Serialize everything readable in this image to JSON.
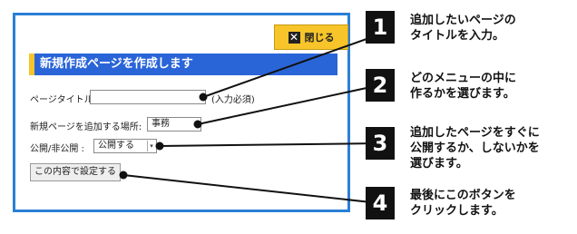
{
  "close_button": {
    "label": "閉じる",
    "icon": "close-icon"
  },
  "panel_title": "新規作成ページを作成します",
  "form": {
    "page_title_label": "ページタイトル:",
    "page_title_value": "",
    "required_note": "(入力必須)",
    "location_label": "新規ページを追加する場所:",
    "location_value": "事務",
    "publish_label": "公開/非公開 :",
    "publish_value": "公開する",
    "submit_label": "この内容で設定する"
  },
  "steps": [
    {
      "number": "1",
      "text": "追加したいページの\nタイトルを入力。"
    },
    {
      "number": "2",
      "text": "どのメニューの中に\n作るかを選びます。"
    },
    {
      "number": "3",
      "text": "追加したページをすぐに\n公開するか、しないかを\n選びます。"
    },
    {
      "number": "4",
      "text": "最後にこのボタンを\nクリックします。"
    }
  ],
  "colors": {
    "frame": "#2a7fd6",
    "title_bar": "#2a65d8",
    "accent": "#f7c52a",
    "step_badge": "#111111"
  }
}
